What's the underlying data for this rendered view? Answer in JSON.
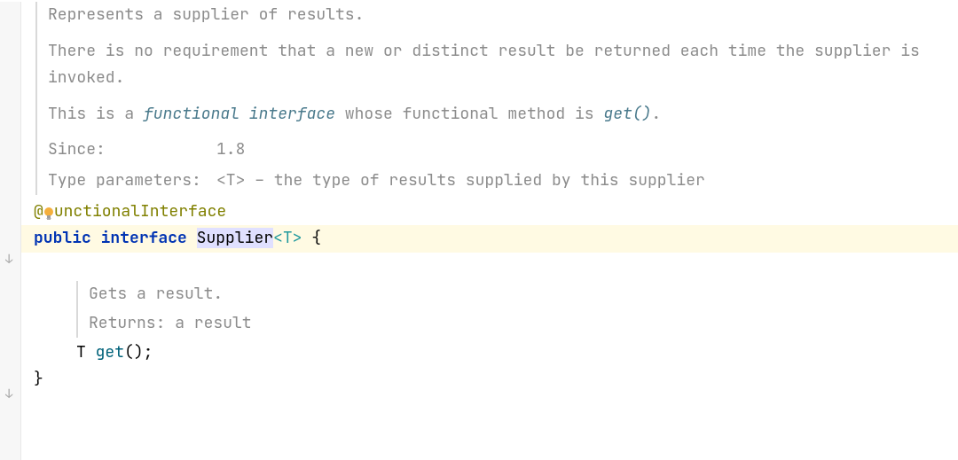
{
  "doc": {
    "para1": "Represents a supplier of results.",
    "para2": "There is no requirement that a new or distinct result be returned each time the supplier is invoked.",
    "para3_pre": "This is a ",
    "para3_link1": "functional interface",
    "para3_mid": " whose functional method is ",
    "para3_link2": "get()",
    "para3_post": ".",
    "since_label": "Since:",
    "since_value": "1.8",
    "typeparam_label": "Type parameters:",
    "typeparam_value": "<T> – the type of results supplied by this supplier"
  },
  "code": {
    "annotation_at": "@",
    "annotation_name": "unctionalInterface",
    "kw_public": "public",
    "kw_interface": "interface",
    "class_name": "Supplier",
    "generic": "<T>",
    "open_brace": " {",
    "close_brace": "}",
    "method_doc_p1": "Gets a result.",
    "method_doc_p2": "Returns: a result",
    "method_ret": "T",
    "method_name": "get",
    "method_sig_tail": "();"
  },
  "icons": {
    "bulb": "bulb-icon",
    "gutter_arrow": "↓"
  }
}
